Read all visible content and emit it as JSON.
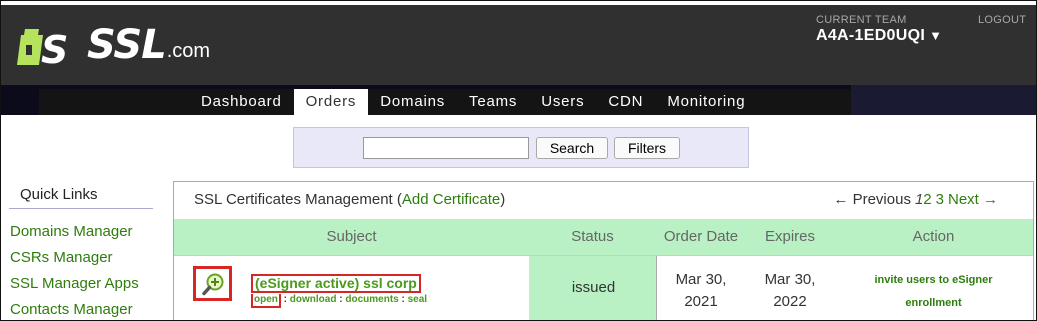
{
  "brand": {
    "logo_text": "SSL",
    "logo_domain": ".com"
  },
  "team": {
    "label": "CURRENT TEAM",
    "value": "A4A-1ED0UQI",
    "caret": "▼"
  },
  "logout_label": "LOGOUT",
  "nav": {
    "tabs": [
      {
        "label": "Dashboard"
      },
      {
        "label": "Orders"
      },
      {
        "label": "Domains"
      },
      {
        "label": "Teams"
      },
      {
        "label": "Users"
      },
      {
        "label": "CDN"
      },
      {
        "label": "Monitoring"
      }
    ],
    "active": "Orders"
  },
  "search": {
    "value": "",
    "search_label": "Search",
    "filters_label": "Filters"
  },
  "quick_links": {
    "title": "Quick Links",
    "items": [
      {
        "label": "Domains Manager"
      },
      {
        "label": "CSRs Manager"
      },
      {
        "label": "SSL Manager Apps"
      },
      {
        "label": "Contacts Manager"
      }
    ]
  },
  "panel": {
    "title_prefix": "SSL Certificates Management (",
    "add_link": "Add Certificate",
    "title_suffix": ")",
    "pager": {
      "previous": "← Previous",
      "current": "1",
      "pages": [
        "2",
        "3"
      ],
      "next": "Next →"
    },
    "columns": [
      "Subject",
      "Status",
      "Order Date",
      "Expires",
      "Action"
    ],
    "rows": [
      {
        "subject": "(eSigner active) ssl corp",
        "subject_actions": {
          "open": "open",
          "sep": ":",
          "download": "download",
          "documents": "documents",
          "seal": "seal"
        },
        "status": "issued",
        "order_date_line1": "Mar 30,",
        "order_date_line2": "2021",
        "expires_line1": "Mar 30,",
        "expires_line2": "2022",
        "action_line1": "invite users to eSigner",
        "action_line2": "enrollment"
      }
    ]
  },
  "colors": {
    "header_bg": "#303030",
    "link_green": "#2e7d0c",
    "table_header_bg": "#b9f0c4",
    "highlight_red": "#d62626"
  }
}
